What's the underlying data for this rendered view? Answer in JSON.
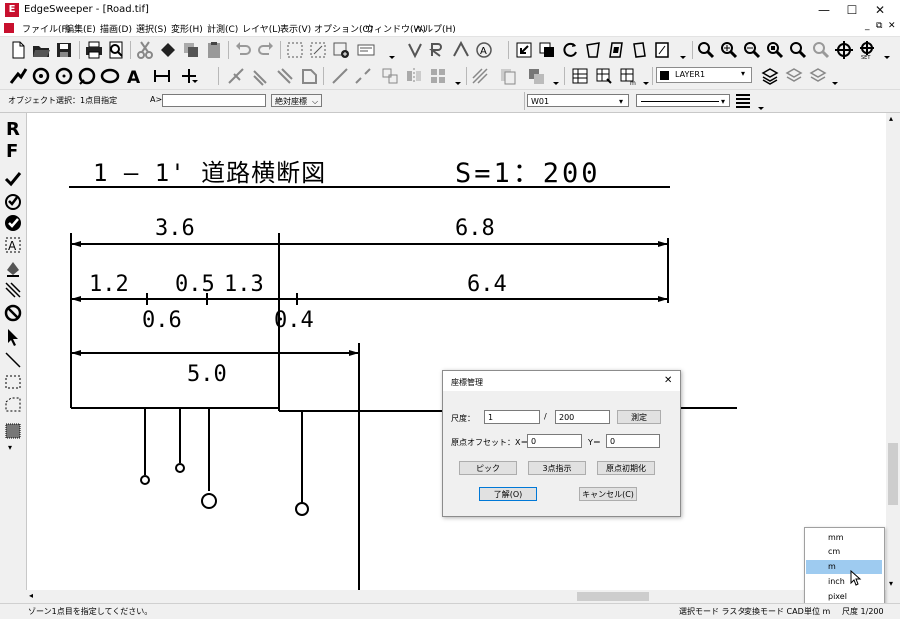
{
  "window": {
    "title": "EdgeSweeper - [Road.tif]",
    "controls": {
      "minimize": "—",
      "maximize": "☐",
      "close": "✕"
    },
    "logo_letter": "E",
    "logo_color": "#c8102e"
  },
  "menubar": {
    "items": [
      "ファイル(F)",
      "編集(E)",
      "描画(D)",
      "選択(S)",
      "変形(H)",
      "計測(C)",
      "レイヤ(L)",
      "表示(V)",
      "オプション(O)",
      "ウィンドウ(W)",
      "ヘルプ(H)"
    ],
    "right_controls": {
      "minimize": "_",
      "restore": "⧉",
      "close": "✕"
    }
  },
  "toolbar3": {
    "layer_name": "LAYER1",
    "layer_color": "#000000"
  },
  "prop_row": {
    "mode_text": "オブジェクト選択：1点目指定",
    "input_label": "A>",
    "input_value": "",
    "coord_mode": "絶対座標",
    "line_width": "W01"
  },
  "lefttools": {
    "r_label": "R",
    "f_label": "F"
  },
  "drawing": {
    "title": "1 – 1'   道路横断図",
    "scale": "S=1：200",
    "dim_top_left": "3.6",
    "dim_top_right": "6.8",
    "dim_mid_1": "1.2",
    "dim_mid_2": "0.5",
    "dim_mid_3": "1.3",
    "dim_mid_right": "6.4",
    "dim_low_1": "0.6",
    "dim_low_2": "0.4",
    "dim_bottom": "5.0"
  },
  "dialog": {
    "title": "座標管理",
    "close_glyph": "✕",
    "scale_label": "尺度：",
    "scale_num": "1",
    "scale_sep": "/",
    "scale_den": "200",
    "measure_btn": "測定",
    "offset_label": "原点オフセット：X＝",
    "offset_x": "0",
    "offset_y_label": "Y＝",
    "offset_y": "0",
    "pick_btn": "ピック",
    "three_point_btn": "3点指示",
    "origin_reset_btn": "原点初期化",
    "ok_btn": "了解(O)",
    "cancel_btn": "キャンセル(C)"
  },
  "unit_dropdown": {
    "options": [
      "mm",
      "cm",
      "m",
      "inch",
      "pixel"
    ],
    "selected": "m",
    "highlight_color": "#9ecbf0"
  },
  "statusbar": {
    "message": "ゾーン1点目を指定してください。",
    "select_mode": "選択モード ラスタ",
    "convert_mode": "変換モード CAD",
    "unit_label": "単位 m",
    "scale_label": "尺度 1/200"
  }
}
